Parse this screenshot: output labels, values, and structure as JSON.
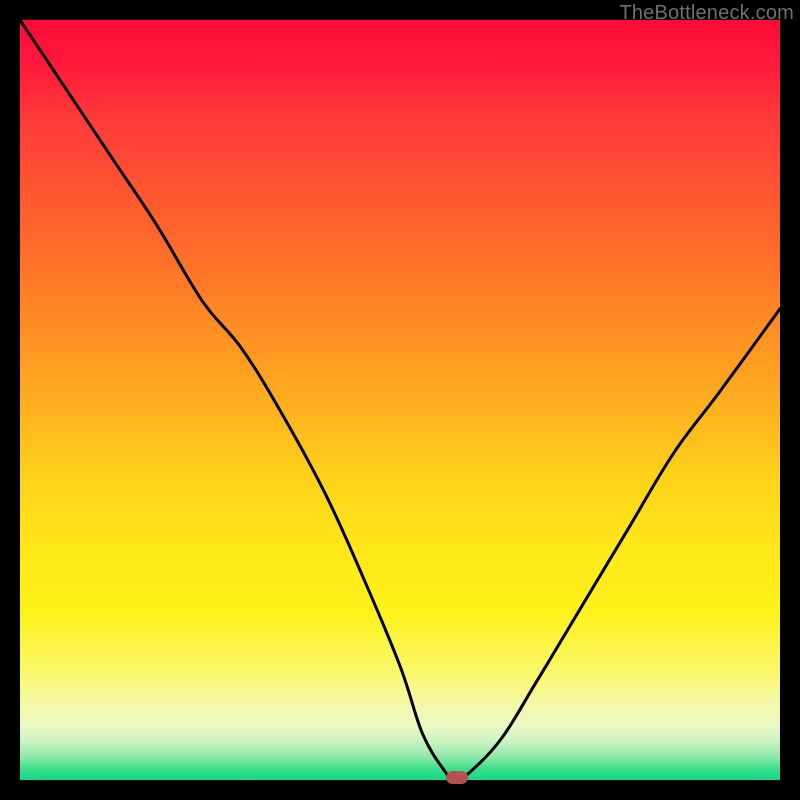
{
  "watermark": "TheBottleneck.com",
  "colors": {
    "frame": "#000000",
    "gradient_top": "#ff0a3a",
    "gradient_bottom": "#17d78a",
    "curve": "#000000",
    "marker": "#b6524e",
    "watermark": "#6f6f6f"
  },
  "chart_data": {
    "type": "line",
    "title": "",
    "xlabel": "",
    "ylabel": "",
    "xlim": [
      0,
      100
    ],
    "ylim": [
      0,
      100
    ],
    "grid": false,
    "legend": false,
    "x": [
      0,
      6,
      12,
      18,
      24,
      29,
      34,
      40,
      45,
      50,
      53,
      56,
      57,
      58,
      63,
      68,
      74,
      80,
      86,
      92,
      100
    ],
    "values": [
      100,
      91,
      82,
      73,
      63,
      57,
      49,
      38,
      27,
      15,
      6,
      1,
      0,
      0,
      5,
      13,
      23,
      33,
      43,
      51,
      62
    ],
    "marker": {
      "x": 57.5,
      "y": 0.3
    },
    "notes": "y is the vertical height of the black curve read as a percentage of the plot area (0 = bottom green band, 100 = top). Values estimated from pixel positions; minimum plateau between x≈55 and x≈58."
  }
}
